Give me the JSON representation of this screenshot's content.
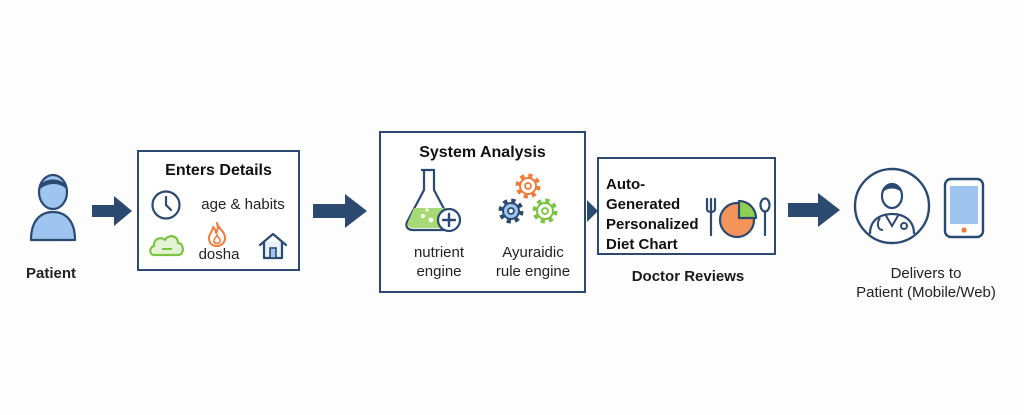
{
  "colors": {
    "navy": "#2c4a70",
    "blue_fill": "#9ec5ef",
    "green": "#7cc243",
    "orange": "#f07c3b",
    "light_bg": "#fdfdfd"
  },
  "patient": {
    "label": "Patient",
    "icon": "person-icon"
  },
  "enters_details": {
    "title": "Enters Details",
    "age_habits": "age & habits",
    "dosha": "dosha",
    "icons": [
      "clock-icon",
      "cloud-icon",
      "flame-icon",
      "house-icon"
    ]
  },
  "system_analysis": {
    "title": "System Analysis",
    "nutrient_line1": "nutrient",
    "nutrient_line2": "engine",
    "rule_line1": "Ayuraidic",
    "rule_line2": "rule engine",
    "icons": [
      "flask-icon",
      "gears-icon"
    ]
  },
  "diet_chart": {
    "line1": "Auto-Generated",
    "line2": "Personalized",
    "line3": "Diet Chart",
    "icons": [
      "fork-icon",
      "pie-chart-icon",
      "spoon-icon"
    ]
  },
  "doctor_reviews": {
    "label": "Doctor Reviews"
  },
  "delivery": {
    "line1": "Delivers to",
    "line2": "Patient (Mobile/Web)",
    "icons": [
      "doctor-icon",
      "phone-icon"
    ]
  }
}
